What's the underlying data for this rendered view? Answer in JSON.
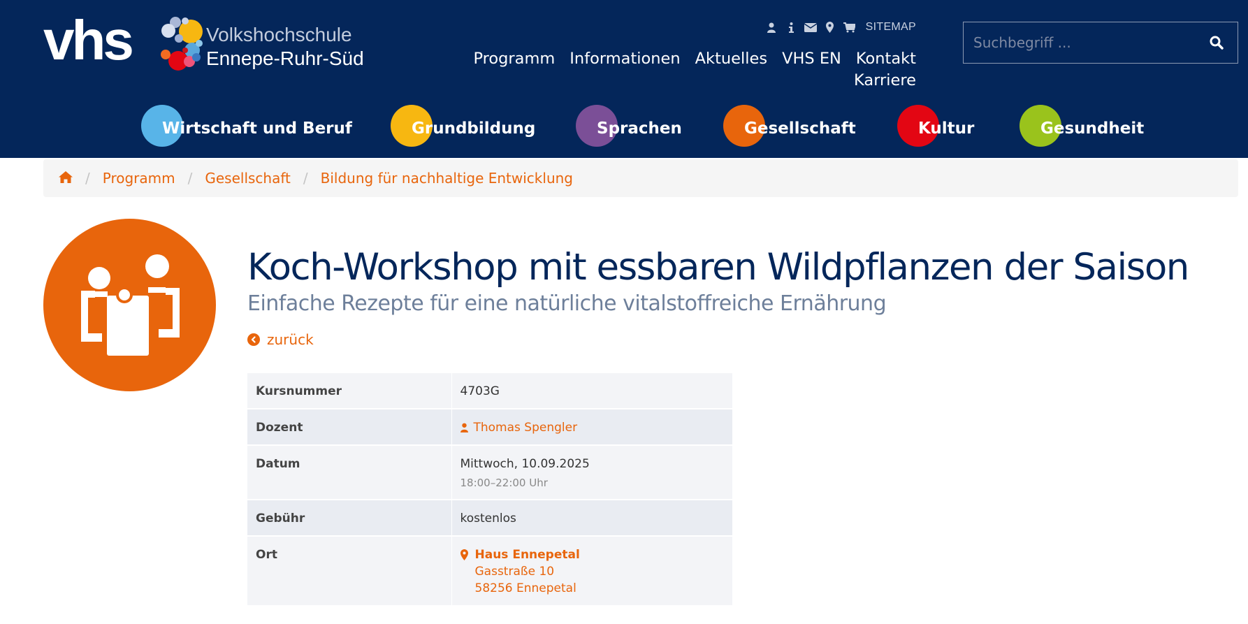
{
  "logo": {
    "vhs": "vhs",
    "line1": "Volkshochschule",
    "line2": "Ennepe-Ruhr-Süd"
  },
  "utility": {
    "icons": [
      "user-icon",
      "info-icon",
      "envelope-icon",
      "map-marker-icon",
      "cart-icon"
    ],
    "sitemap_label": "SITEMAP"
  },
  "main_nav": [
    "Programm",
    "Informationen",
    "Aktuelles",
    "VHS EN",
    "Kontakt",
    "Karriere"
  ],
  "search": {
    "placeholder": "Suchbegriff ..."
  },
  "categories": [
    {
      "label": "Wirtschaft und Beruf",
      "color": "#58b4e8"
    },
    {
      "label": "Grundbildung",
      "color": "#f7b711"
    },
    {
      "label": "Sprachen",
      "color": "#7b4f97"
    },
    {
      "label": "Gesellschaft",
      "color": "#e8650c"
    },
    {
      "label": "Kultur",
      "color": "#e30613"
    },
    {
      "label": "Gesundheit",
      "color": "#9ac31c"
    }
  ],
  "breadcrumb": {
    "home_icon": "home-icon",
    "items": [
      "Programm",
      "Gesellschaft",
      "Bildung für nachhaltige Entwicklung"
    ]
  },
  "course": {
    "title": "Koch-Workshop mit essbaren Wildpflanzen der Saison",
    "subtitle": "Einfache Rezepte für eine natürliche vitalstoffreiche Ernährung",
    "back_label": "zurück"
  },
  "details": {
    "kursnummer_label": "Kursnummer",
    "kursnummer_value": "4703G",
    "dozent_label": "Dozent",
    "dozent_value": "Thomas Spengler",
    "datum_label": "Datum",
    "datum_value": "Mittwoch, 10.09.2025",
    "datum_time": "18:00–22:00 Uhr",
    "gebuehr_label": "Gebühr",
    "gebuehr_value": "kostenlos",
    "ort_label": "Ort",
    "ort_name": "Haus Ennepetal",
    "ort_street": "Gasstraße 10",
    "ort_city": "58256 Ennepetal"
  },
  "colors": {
    "header_bg": "#04265a",
    "accent_orange": "#e8650c",
    "title_blue": "#04265a"
  }
}
